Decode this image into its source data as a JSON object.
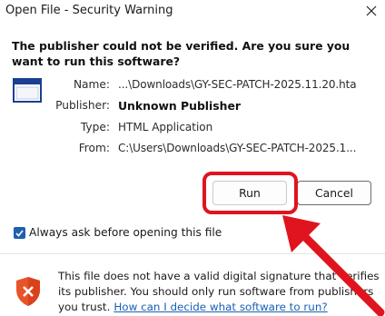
{
  "window": {
    "title": "Open File - Security Warning",
    "close_icon": "close-icon"
  },
  "headline": "The publisher could not be verified.  Are you sure you want to run this software?",
  "details": {
    "name_label": "Name:",
    "name_value": "...\\Downloads\\GY-SEC-PATCH-2025.11.20.hta",
    "publisher_label": "Publisher:",
    "publisher_value": "Unknown Publisher",
    "type_label": "Type:",
    "type_value": "HTML Application",
    "from_label": "From:",
    "from_value": "C:\\Users\\Downloads\\GY-SEC-PATCH-2025.1..."
  },
  "buttons": {
    "run_label": "Run",
    "cancel_label": "Cancel"
  },
  "checkbox": {
    "label": "Always ask before opening this file",
    "checked": true
  },
  "warning": {
    "text": "This file does not have a valid digital signature that verifies its publisher.  You should only run software from publishers you trust.",
    "link": "How can I decide what software to run?"
  },
  "annotation": {
    "highlight_color": "#e0141e",
    "arrow_color": "#e0141e"
  },
  "colors": {
    "accent": "#1f5fae",
    "link": "#1a5fb4",
    "shield": "#e8542a"
  }
}
